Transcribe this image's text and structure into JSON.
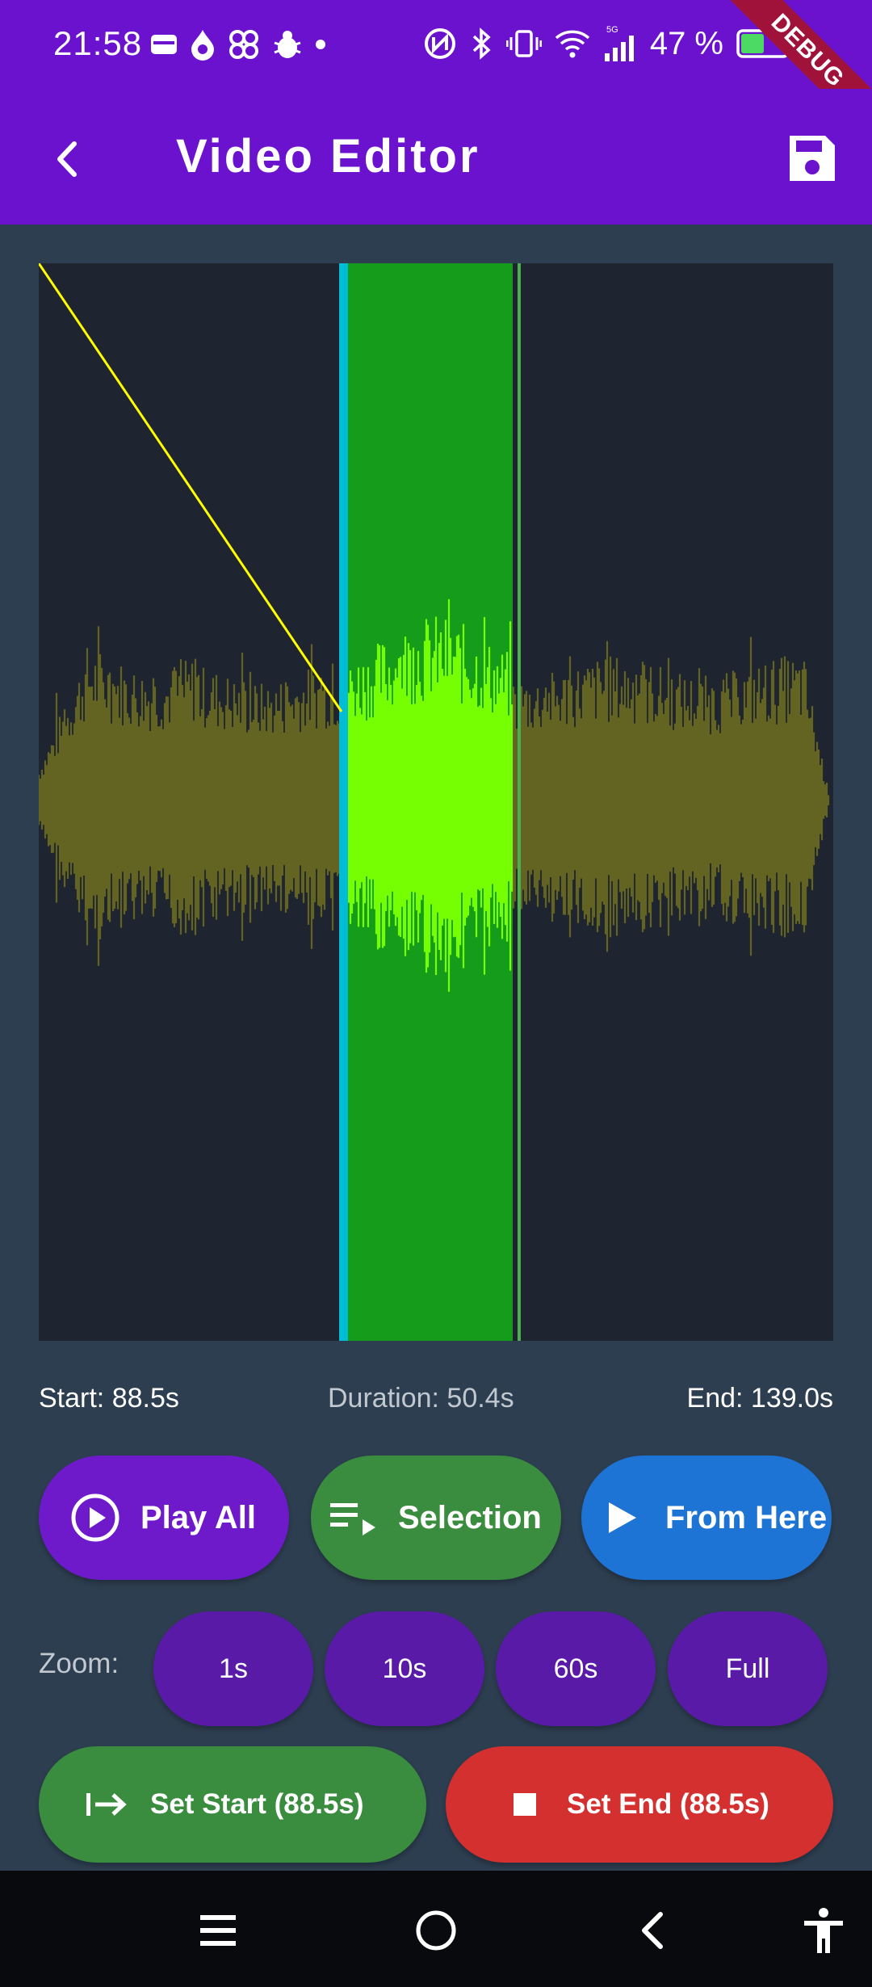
{
  "status_bar": {
    "time": "21:58",
    "left_icons": [
      "wallet-icon",
      "drop-icon",
      "fan-icon",
      "bug-icon",
      "dot-icon"
    ],
    "right_icons": [
      "nfc-icon",
      "bluetooth-icon",
      "vibrate-icon",
      "wifi-icon",
      "signal-5g-icon",
      "battery-icon"
    ],
    "battery_percent": "47 %",
    "debug_label": "DEBUG"
  },
  "app_bar": {
    "title": "Video Editor",
    "back_icon": "chevron-left-icon",
    "save_icon": "save-icon",
    "background": "#6b12cf"
  },
  "waveform": {
    "background": "#1e2430",
    "selection_start_seconds": 88.5,
    "selection_end_seconds": 139.0,
    "selection_color": "#149c1a",
    "selected_wave_color": "#76ff03",
    "unselected_wave_color": "#636322",
    "playhead_color": "#00bcd4",
    "indicator_line_color": "#ffff00"
  },
  "info": {
    "start": "Start: 88.5s",
    "duration": "Duration: 50.4s",
    "end": "End: 139.0s"
  },
  "playback_buttons": {
    "play_all": "Play All",
    "selection": "Selection",
    "from_here": "From Here"
  },
  "zoom": {
    "label": "Zoom:",
    "options": [
      "1s",
      "10s",
      "60s",
      "Full"
    ]
  },
  "markers": {
    "set_start": "Set Start (88.5s)",
    "set_end": "Set End (88.5s)"
  },
  "nav_bar": {
    "icons": [
      "menu-icon",
      "home-icon",
      "back-icon",
      "accessibility-icon"
    ]
  }
}
